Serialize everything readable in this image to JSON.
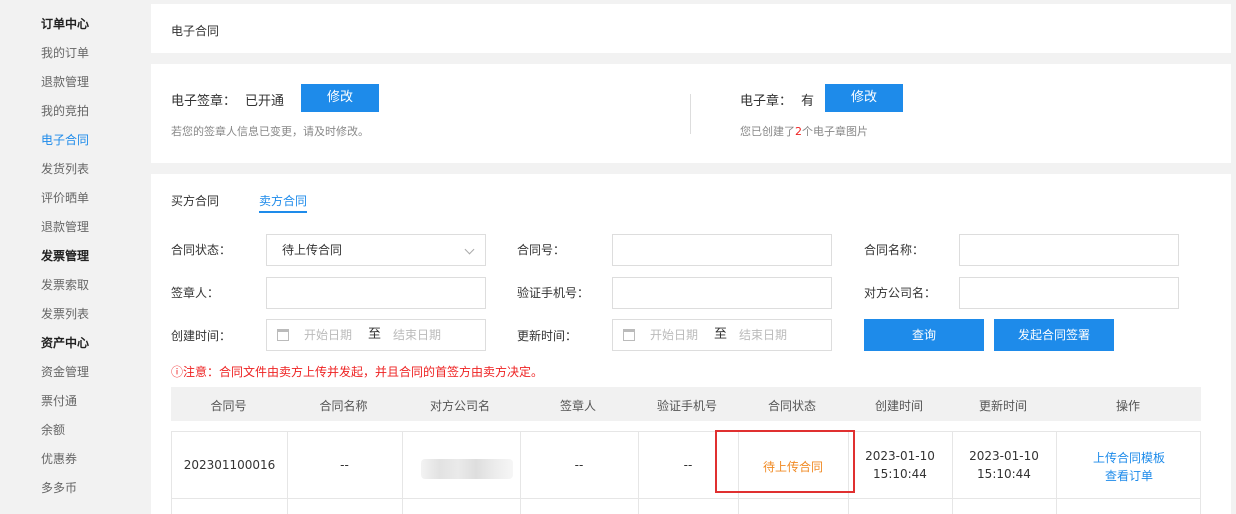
{
  "sidebar": {
    "items": [
      {
        "label": "订单中心",
        "type": "group"
      },
      {
        "label": "我的订单",
        "type": "item"
      },
      {
        "label": "退款管理",
        "type": "item"
      },
      {
        "label": "我的竞拍",
        "type": "item"
      },
      {
        "label": "电子合同",
        "type": "active"
      },
      {
        "label": "发货列表",
        "type": "item"
      },
      {
        "label": "评价晒单",
        "type": "item"
      },
      {
        "label": "退款管理",
        "type": "item"
      },
      {
        "label": "发票管理",
        "type": "group"
      },
      {
        "label": "发票索取",
        "type": "item"
      },
      {
        "label": "发票列表",
        "type": "item"
      },
      {
        "label": "资产中心",
        "type": "group"
      },
      {
        "label": "资金管理",
        "type": "item"
      },
      {
        "label": "票付通",
        "type": "item"
      },
      {
        "label": "余额",
        "type": "item"
      },
      {
        "label": "优惠券",
        "type": "item"
      },
      {
        "label": "多多币",
        "type": "item"
      }
    ]
  },
  "page_title": "电子合同",
  "signature": {
    "label": "电子签章：",
    "status": "已开通",
    "button": "修改",
    "hint": "若您的签章人信息已变更，请及时修改。"
  },
  "seal": {
    "label": "电子章：",
    "status": "有",
    "button": "修改",
    "hint_prefix": "您已创建了",
    "hint_count": "2",
    "hint_suffix": "个电子章图片"
  },
  "tabs": [
    {
      "label": "买方合同",
      "active": false
    },
    {
      "label": "卖方合同",
      "active": true
    }
  ],
  "filters": {
    "status_label": "合同状态：",
    "status_value": "待上传合同",
    "number_label": "合同号：",
    "name_label": "合同名称：",
    "signer_label": "签章人：",
    "phone_label": "验证手机号：",
    "company_label": "对方公司名：",
    "created_label": "创建时间：",
    "updated_label": "更新时间：",
    "date_start": "开始日期",
    "date_to": "至",
    "date_end": "结束日期",
    "query_button": "查询",
    "initiate_button": "发起合同签署"
  },
  "notice": "ⓘ注意：合同文件由卖方上传并发起，并且合同的首签方由卖方决定。",
  "table": {
    "headers": [
      "合同号",
      "合同名称",
      "对方公司名",
      "签章人",
      "验证手机号",
      "合同状态",
      "创建时间",
      "更新时间",
      "操作"
    ],
    "rows": [
      {
        "number": "202301100016",
        "name": "--",
        "signer": "--",
        "phone": "--",
        "status": "待上传合同",
        "created_date": "2023-01-10",
        "created_time": "15:10:44",
        "updated_date": "2023-01-10",
        "updated_time": "15:10:44",
        "action_upload": "上传合同模板",
        "action_view": "查看订单"
      }
    ]
  },
  "colors": {
    "accent": "#1e8bea",
    "status_pending": "#f08a24",
    "notice": "#e22222",
    "highlight_box": "#e03030"
  }
}
